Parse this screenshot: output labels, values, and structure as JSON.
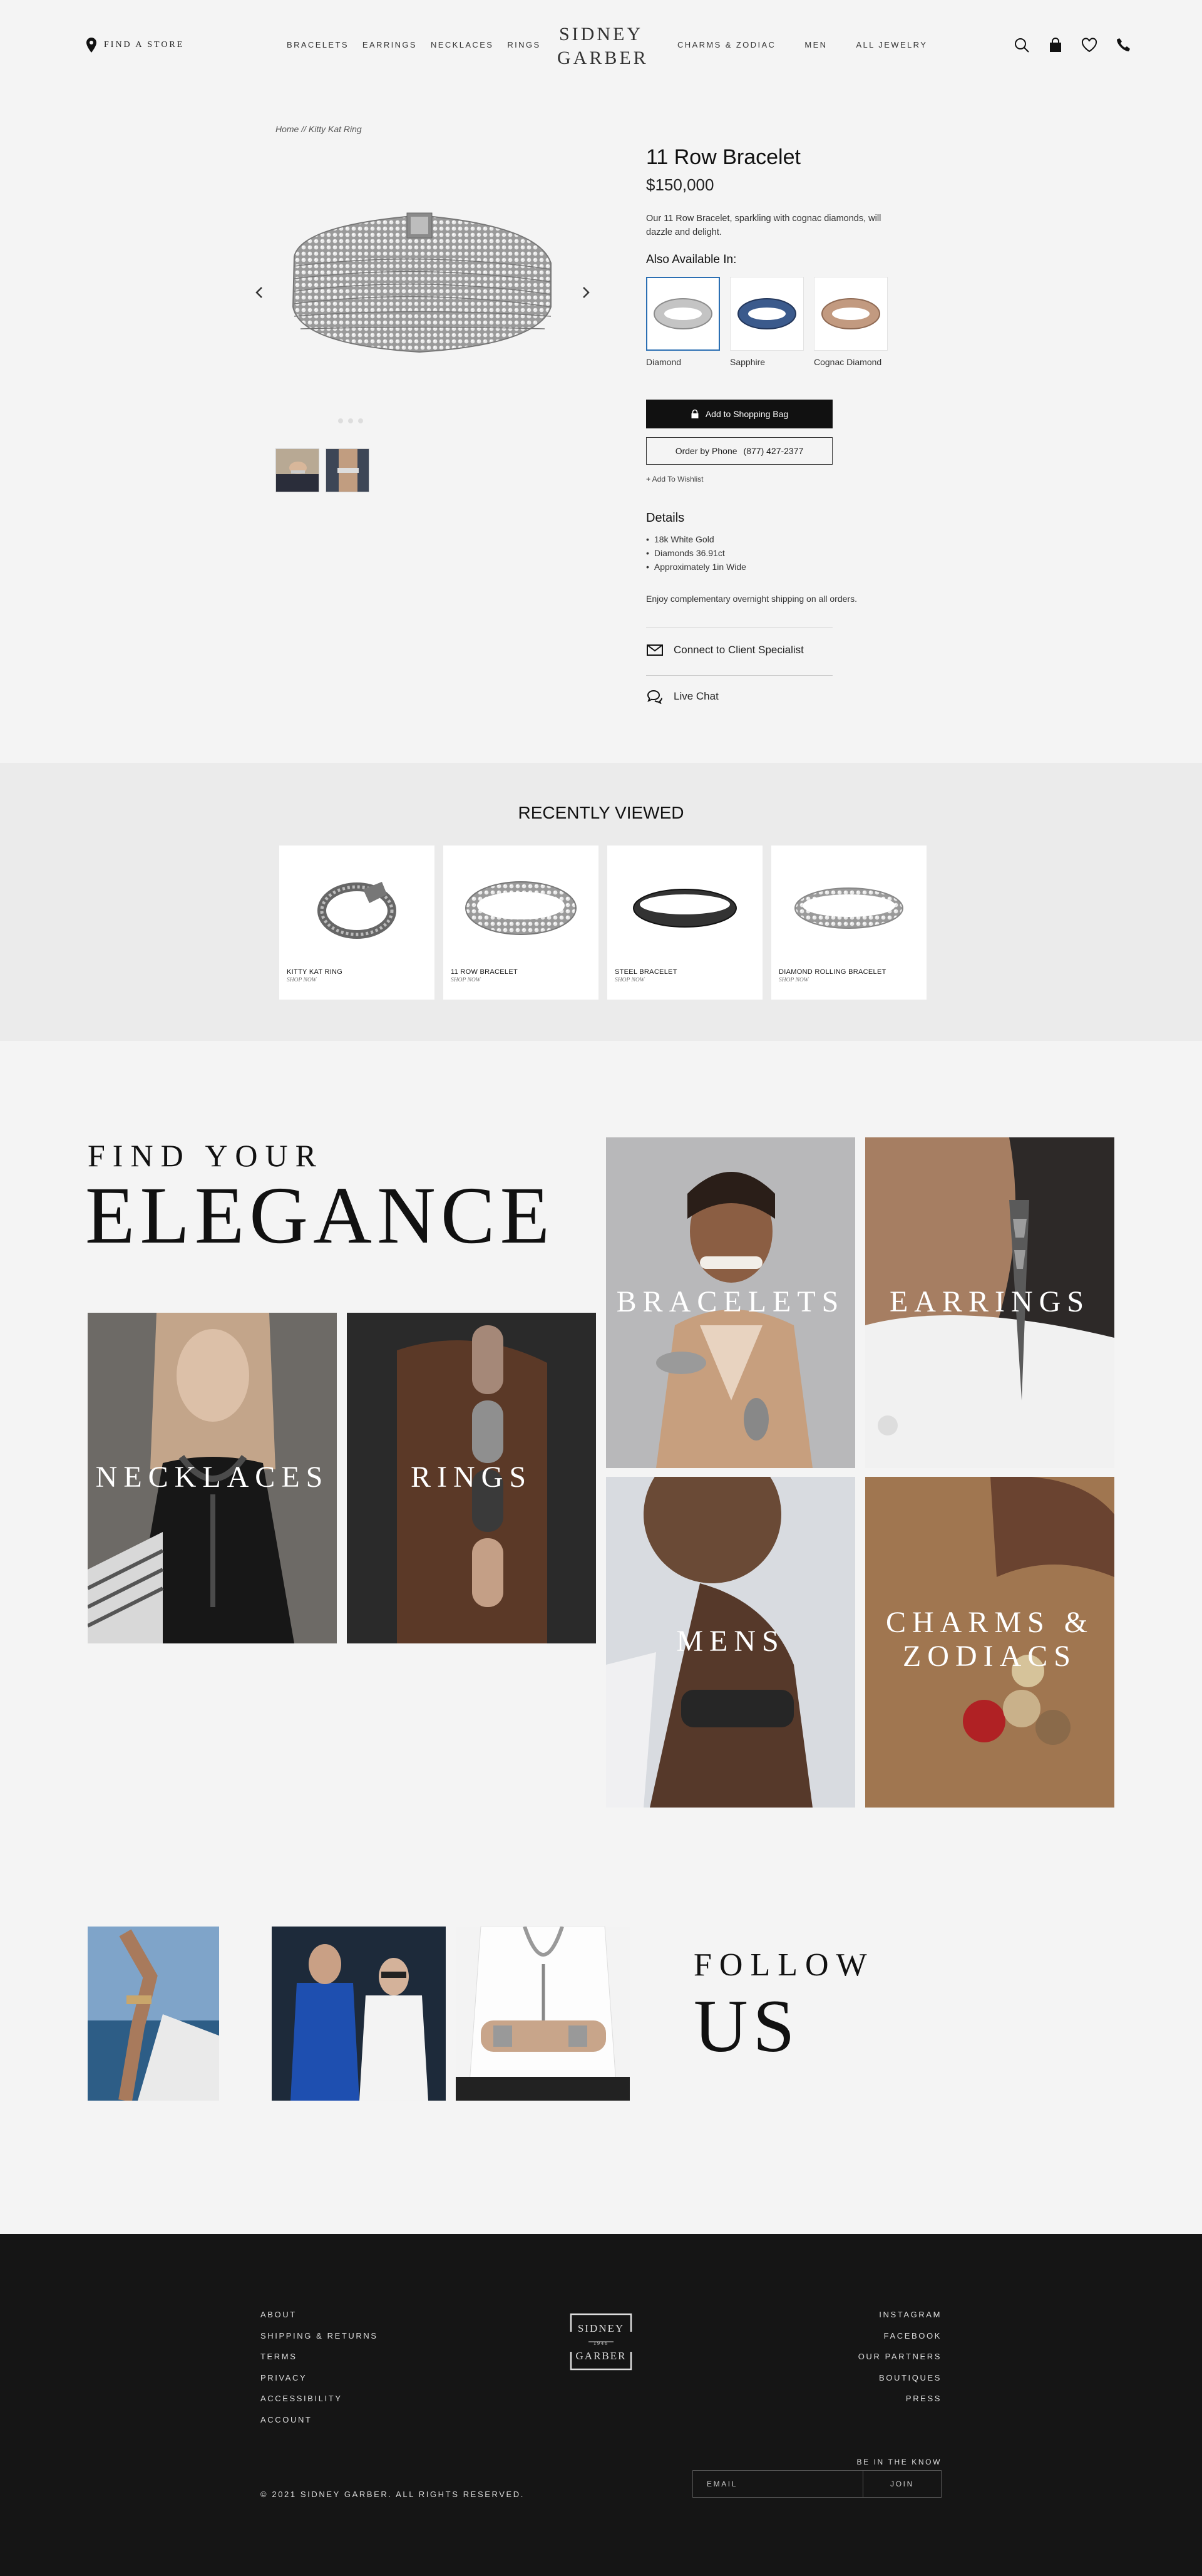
{
  "header": {
    "find_store": "FIND A STORE",
    "nav_left": [
      "BRACELETS",
      "EARRINGS",
      "NECKLACES",
      "RINGS"
    ],
    "logo_line1": "SIDNEY",
    "logo_line2": "GARBER",
    "nav_right": [
      "CHARMS & ZODIAC",
      "MEN",
      "ALL JEWELRY"
    ],
    "icons": [
      "search-icon",
      "shopping-bag-icon",
      "heart-icon",
      "phone-icon"
    ]
  },
  "breadcrumb": "Home // Kitty Kat Ring",
  "product": {
    "title": "11 Row Bracelet",
    "price": "$150,000",
    "description": "Our 11 Row Bracelet, sparkling with cognac diamonds, will dazzle and delight.",
    "also_available": "Also Available In:",
    "variants": [
      {
        "label": "Diamond",
        "color": "#b9b9b9",
        "selected": true
      },
      {
        "label": "Sapphire",
        "color": "#3b5a8c",
        "selected": false
      },
      {
        "label": "Cognac Diamond",
        "color": "#b58a72",
        "selected": false
      }
    ],
    "add_to_bag": "Add to Shopping Bag",
    "order_by_phone": "Order by Phone",
    "phone": "(877) 427-2377",
    "wishlist": "+ Add To Wishlist",
    "details_heading": "Details",
    "details": [
      "18k White Gold",
      "Diamonds 36.91ct",
      "Approximately 1in Wide"
    ],
    "shipping": "Enjoy complementary overnight shipping on all orders.",
    "connect": "Connect to Client Specialist",
    "live_chat": "Live Chat"
  },
  "recently_viewed": {
    "heading": "RECENTLY VIEWED",
    "items": [
      {
        "name": "KITTY KAT RING",
        "sub": "SHOP NOW"
      },
      {
        "name": "11 ROW BRACELET",
        "sub": "SHOP NOW"
      },
      {
        "name": "STEEL BRACELET",
        "sub": "SHOP NOW"
      },
      {
        "name": "DIAMOND ROLLING BRACELET",
        "sub": "SHOP NOW"
      }
    ]
  },
  "elegance": {
    "line1": "FIND YOUR",
    "line2": "ELEGANCE",
    "tiles": {
      "bracelets": "BRACELETS",
      "earrings": "EARRINGS",
      "necklaces": "NECKLACES",
      "rings": "RINGS",
      "mens": "MENS",
      "charms_1": "CHARMS &",
      "charms_2": "ZODIACS"
    }
  },
  "follow": {
    "line1": "FOLLOW",
    "line2": "US"
  },
  "footer": {
    "left_links": [
      "ABOUT",
      "SHIPPING & RETURNS",
      "TERMS",
      "PRIVACY",
      "ACCESSIBILITY",
      "ACCOUNT"
    ],
    "right_links": [
      "INSTAGRAM",
      "FACEBOOK",
      "OUR PARTNERS",
      "BOUTIQUES",
      "PRESS"
    ],
    "logo_top": "SIDNEY",
    "logo_year": "1946",
    "logo_bottom": "GARBER",
    "be_in_the_know": "BE IN THE KNOW",
    "email_placeholder": "EMAIL",
    "join": "JOIN",
    "copyright": "© 2021 SIDNEY GARBER. ALL RIGHTS RESERVED."
  }
}
